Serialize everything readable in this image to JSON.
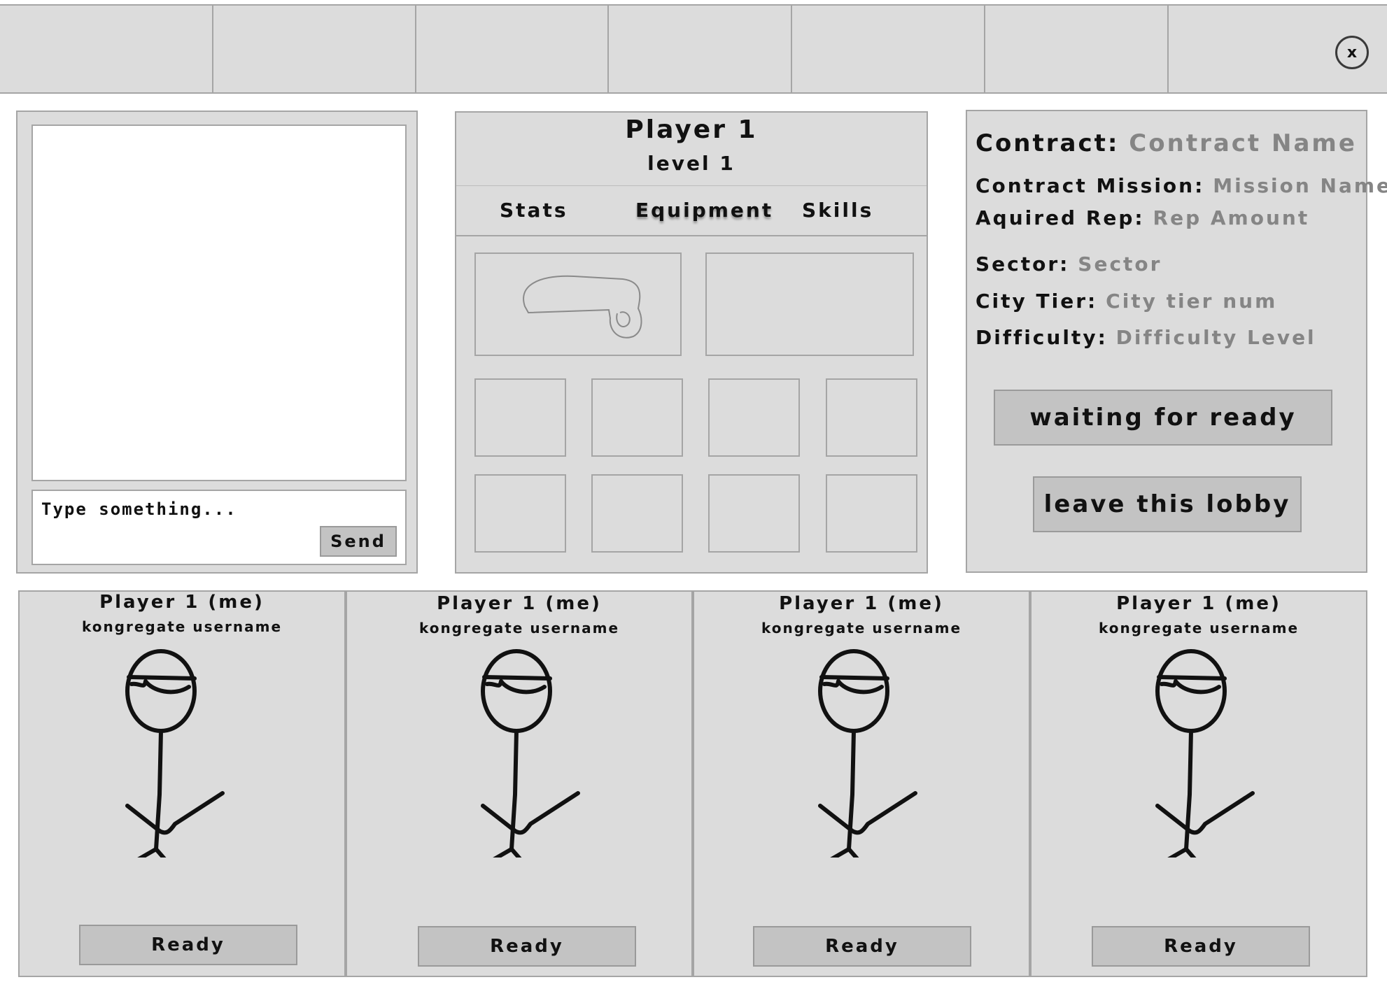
{
  "topbar": {
    "tab_count": 7,
    "close_label": "x"
  },
  "chat": {
    "input_placeholder": "Type something...",
    "send_label": "Send"
  },
  "player": {
    "name": "Player 1",
    "level": "level 1",
    "tabs": [
      "Stats",
      "Equipment",
      "Skills"
    ],
    "active_tab": "Equipment"
  },
  "contract": {
    "contract_label": "Contract:",
    "contract_value": "Contract Name",
    "mission_label": "Contract Mission:",
    "mission_value": "Mission Name",
    "rep_label": "Aquired Rep:",
    "rep_value": "Rep Amount",
    "sector_label": "Sector:",
    "sector_value": "Sector",
    "tier_label": "City Tier:",
    "tier_value": "City tier num",
    "difficulty_label": "Difficulty:",
    "difficulty_value": "Difficulty Level",
    "ready_button": "waiting for ready",
    "leave_button": "leave this lobby"
  },
  "players": [
    {
      "name": "Player 1 (me)",
      "username": "kongregate username",
      "ready_label": "Ready"
    },
    {
      "name": "Player 1 (me)",
      "username": "kongregate username",
      "ready_label": "Ready"
    },
    {
      "name": "Player 1 (me)",
      "username": "kongregate username",
      "ready_label": "Ready"
    },
    {
      "name": "Player 1 (me)",
      "username": "kongregate username",
      "ready_label": "Ready"
    }
  ],
  "colors": {
    "panel": "#dcdcdc",
    "border": "#a5a5a5",
    "button": "#c3c3c3",
    "value_text": "#858585"
  }
}
